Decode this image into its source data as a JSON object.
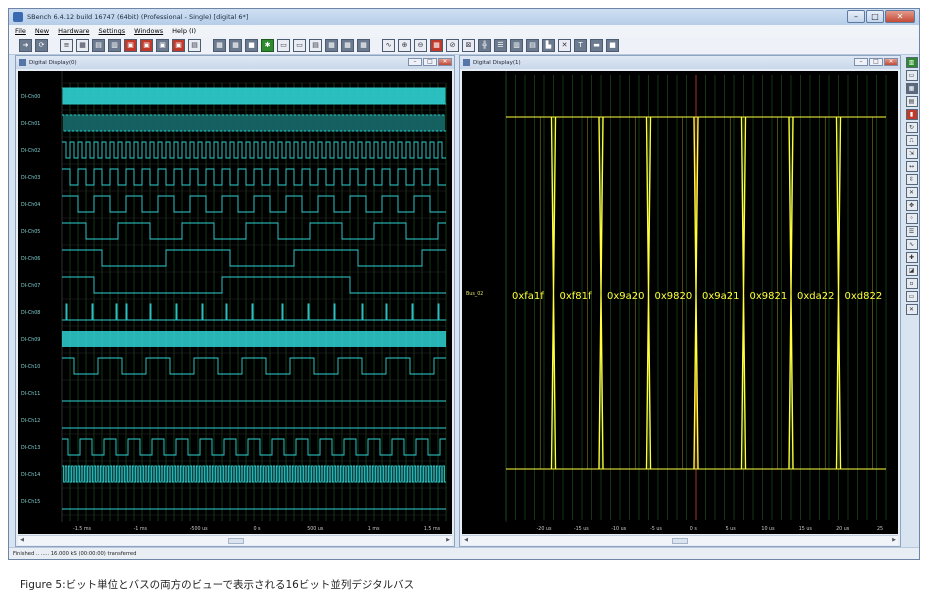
{
  "app": {
    "title": "SBench 6.4.12 build 16747 (64bit) (Professional - Single)   [digital 6*]",
    "menu": [
      "File",
      "New",
      "Hardware",
      "Settings",
      "Windows",
      "Help (I)"
    ],
    "window_buttons": {
      "minimize": "–",
      "maximize": "□",
      "close": "✕"
    },
    "status": "Finished .. ..... 16.000 kS (00:00:00) transferred"
  },
  "toolbar": {
    "buttons": [
      {
        "icon": "arrow-icon",
        "glyph": "➜",
        "style": "dark"
      },
      {
        "icon": "refresh-icon",
        "glyph": "⟳",
        "style": "dark"
      },
      {
        "icon": "list-icon",
        "glyph": "≡",
        "style": "light"
      },
      {
        "icon": "table-icon",
        "glyph": "▦",
        "style": "light"
      },
      {
        "icon": "calc-icon",
        "glyph": "▤",
        "style": "dark"
      },
      {
        "icon": "chart-icon",
        "glyph": "▥",
        "style": "dark"
      },
      {
        "icon": "export-icon",
        "glyph": "▣",
        "style": "red"
      },
      {
        "icon": "import-icon",
        "glyph": "▣",
        "style": "red"
      },
      {
        "icon": "analyze-icon",
        "glyph": "▣",
        "style": "dark"
      },
      {
        "icon": "report-icon",
        "glyph": "▣",
        "style": "red"
      },
      {
        "icon": "print-icon",
        "glyph": "▤",
        "style": "light"
      },
      {
        "icon": "display-icon",
        "glyph": "▦",
        "style": "dark"
      },
      {
        "icon": "digital-icon",
        "glyph": "▦",
        "style": "dark"
      },
      {
        "icon": "save-icon",
        "glyph": "■",
        "style": "dark"
      },
      {
        "icon": "settings-gear-icon",
        "glyph": "✱",
        "style": "green"
      },
      {
        "icon": "window-icon",
        "glyph": "▭",
        "style": "light"
      },
      {
        "icon": "split-icon",
        "glyph": "▭",
        "style": "light"
      },
      {
        "icon": "doc-icon",
        "glyph": "▤",
        "style": "light"
      },
      {
        "icon": "tile-icon",
        "glyph": "▦",
        "style": "dark"
      },
      {
        "icon": "cascade-icon",
        "glyph": "▦",
        "style": "dark"
      },
      {
        "icon": "tile2-icon",
        "glyph": "▦",
        "style": "dark"
      },
      {
        "icon": "wave-icon",
        "glyph": "∿",
        "style": "light"
      },
      {
        "icon": "zoom-in-icon",
        "glyph": "⊕",
        "style": "light"
      },
      {
        "icon": "zoom-out-icon",
        "glyph": "⊖",
        "style": "light"
      },
      {
        "icon": "grid-icon",
        "glyph": "▦",
        "style": "red"
      },
      {
        "icon": "cursor-icon",
        "glyph": "⊘",
        "style": "light"
      },
      {
        "icon": "measure-icon",
        "glyph": "⊠",
        "style": "light"
      },
      {
        "icon": "crosshair-icon",
        "glyph": "╬",
        "style": "dark"
      },
      {
        "icon": "bars-icon",
        "glyph": "☰",
        "style": "dark"
      },
      {
        "icon": "columns-icon",
        "glyph": "▥",
        "style": "dark"
      },
      {
        "icon": "layout-icon",
        "glyph": "▤",
        "style": "dark"
      },
      {
        "icon": "flag-icon",
        "glyph": "▙",
        "style": "dark"
      },
      {
        "icon": "x-icon",
        "glyph": "✕",
        "style": "light"
      },
      {
        "icon": "t-icon",
        "glyph": "T",
        "style": "dark"
      },
      {
        "icon": "hbar-icon",
        "glyph": "▬",
        "style": "dark"
      },
      {
        "icon": "block-icon",
        "glyph": "■",
        "style": "dark"
      }
    ]
  },
  "left_window": {
    "title": "Digital Display(0)",
    "channels": [
      "DI-Ch00",
      "DI-Ch01",
      "DI-Ch02",
      "DI-Ch03",
      "DI-Ch04",
      "DI-Ch05",
      "DI-Ch06",
      "DI-Ch07",
      "DI-Ch08",
      "DI-Ch09",
      "DI-Ch10",
      "DI-Ch11",
      "DI-Ch12",
      "DI-Ch13",
      "DI-Ch14",
      "DI-Ch15"
    ],
    "x_ticks": [
      "-1.5 ms",
      "-1 ms",
      "-500 us",
      "0 s",
      "500 us",
      "1 ms",
      "1.5 ms"
    ],
    "colors": {
      "trace": "#2fd3d3",
      "grid": "#1e5a1e",
      "label": "#7fd0d0"
    }
  },
  "right_window": {
    "title": "Digital Display(1)",
    "bus_name": "Bus_02",
    "bus_values": [
      "0xfa1f",
      "0xf81f",
      "0x9a20",
      "0x9820",
      "0x9a21",
      "0x9821",
      "0xda22",
      "0xd822"
    ],
    "x_ticks": [
      "-20 us",
      "-15 us",
      "-10 us",
      "-5 us",
      "0 s",
      "5 us",
      "10 us",
      "15 us",
      "20 us",
      "25"
    ],
    "colors": {
      "trace": "#ffff3c",
      "grid": "#1e5a1e",
      "trigger": "#c0392b"
    }
  },
  "toolstrip": {
    "buttons": [
      {
        "icon": "panel-green-icon",
        "glyph": "▥",
        "style": "green"
      },
      {
        "icon": "panel-blank-icon",
        "glyph": "▭",
        "style": "light"
      },
      {
        "icon": "meter-icon",
        "glyph": "▦",
        "style": "dark"
      },
      {
        "icon": "calc2-icon",
        "glyph": "▤",
        "style": "light"
      },
      {
        "icon": "red-tool-icon",
        "glyph": "▮",
        "style": "red"
      },
      {
        "icon": "rotate-icon",
        "glyph": "↻",
        "style": "light"
      },
      {
        "icon": "pulse-icon",
        "glyph": "⎍",
        "style": "light"
      },
      {
        "icon": "export2-icon",
        "glyph": "⇲",
        "style": "light"
      },
      {
        "icon": "span-icon",
        "glyph": "↔",
        "style": "light"
      },
      {
        "icon": "compress-icon",
        "glyph": "⇳",
        "style": "light"
      },
      {
        "icon": "close-x-icon",
        "glyph": "✕",
        "style": "light"
      },
      {
        "icon": "expand-icon",
        "glyph": "✥",
        "style": "light"
      },
      {
        "icon": "dots-icon",
        "glyph": "⁘",
        "style": "light"
      },
      {
        "icon": "lines-icon",
        "glyph": "☰",
        "style": "light"
      },
      {
        "icon": "wave2-icon",
        "glyph": "∿",
        "style": "light"
      },
      {
        "icon": "cross2-icon",
        "glyph": "✚",
        "style": "light"
      },
      {
        "icon": "tag-icon",
        "glyph": "◪",
        "style": "light"
      },
      {
        "icon": "small-icon",
        "glyph": "▫",
        "style": "light"
      },
      {
        "icon": "gray-icon",
        "glyph": "▭",
        "style": "light"
      },
      {
        "icon": "delete-icon",
        "glyph": "✕",
        "style": "light"
      }
    ]
  },
  "caption": "Figure 5:ビット単位とバスの両方のビューで表示される16ビット並列デジタルバス"
}
